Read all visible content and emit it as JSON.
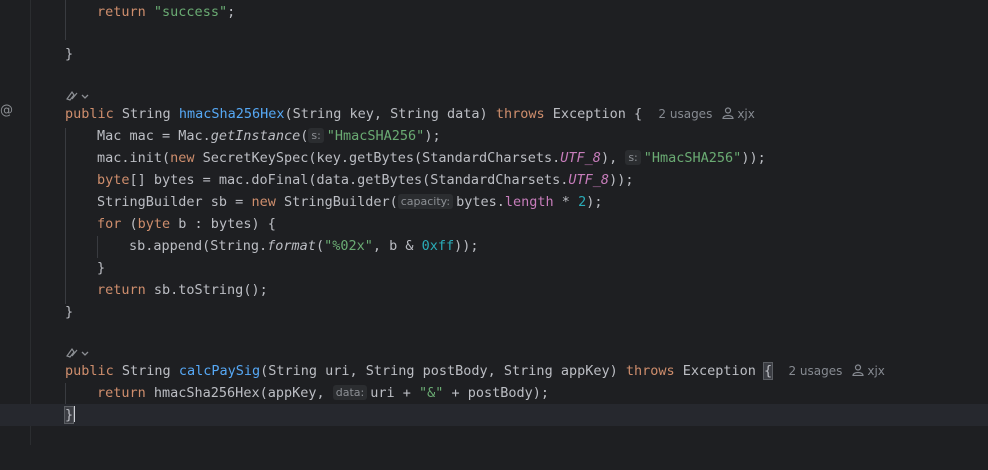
{
  "editor": {
    "gutter_mark": "@",
    "lines": {
      "l1_kw": "return",
      "l1_str": "\"success\"",
      "l1_end": ";",
      "l3_brace": "}",
      "m1_kw_public": "public",
      "m1_type": " String ",
      "m1_name": "hmacSha256Hex",
      "m1_params": "(String key, String data) ",
      "m1_throws": "throws",
      "m1_exc": " Exception {",
      "m1_usages": "2 usages",
      "m1_author": "xjx",
      "m1_l1_a": "Mac mac = Mac.",
      "m1_l1_fn": "getInstance",
      "m1_l1_b": "(",
      "m1_l1_hint": "s:",
      "m1_l1_str": "\"HmacSHA256\"",
      "m1_l1_c": ");",
      "m1_l2_a": "mac.init(",
      "m1_l2_new": "new",
      "m1_l2_b": " SecretKeySpec(key.getBytes(StandardCharsets.",
      "m1_l2_field": "UTF_8",
      "m1_l2_c": "), ",
      "m1_l2_hint": "s:",
      "m1_l2_str": "\"HmacSHA256\"",
      "m1_l2_d": "));",
      "m1_l3_kw": "byte",
      "m1_l3_a": "[] bytes = mac.doFinal(data.getBytes(StandardCharsets.",
      "m1_l3_field": "UTF_8",
      "m1_l3_b": "));",
      "m1_l4_a": "StringBuilder sb = ",
      "m1_l4_new": "new",
      "m1_l4_b": " StringBuilder(",
      "m1_l4_hint": "capacity:",
      "m1_l4_c": "bytes.",
      "m1_l4_field": "length",
      "m1_l4_d": " * ",
      "m1_l4_num": "2",
      "m1_l4_e": ");",
      "m1_l5_for": "for",
      "m1_l5_a": " (",
      "m1_l5_byte": "byte",
      "m1_l5_b": " b : bytes) {",
      "m1_l6_a": "sb.append(String.",
      "m1_l6_fn": "format",
      "m1_l6_b": "(",
      "m1_l6_str": "\"%02x\"",
      "m1_l6_c": ", b & ",
      "m1_l6_num": "0xff",
      "m1_l6_d": "));",
      "m1_l7": "}",
      "m1_l8_kw": "return",
      "m1_l8_a": " sb.toString();",
      "m1_close": "}",
      "m2_kw_public": "public",
      "m2_type": " String ",
      "m2_name": "calcPaySig",
      "m2_params": "(String uri, String postBody, String appKey) ",
      "m2_throws": "throws",
      "m2_exc": " Exception ",
      "m2_brace": "{",
      "m2_usages": "2 usages",
      "m2_author": "xjx",
      "m2_l1_kw": "return",
      "m2_l1_a": " hmacSha256Hex(appKey, ",
      "m2_l1_hint": "data:",
      "m2_l1_b": "uri + ",
      "m2_l1_str": "\"&\"",
      "m2_l1_c": " + postBody);",
      "m2_close": "}"
    }
  },
  "colors": {
    "background": "#1e1f22",
    "keyword": "#cf8e6d",
    "string": "#6aab73",
    "function": "#56a8f5",
    "field": "#c77dbb",
    "number": "#2aacb8"
  }
}
